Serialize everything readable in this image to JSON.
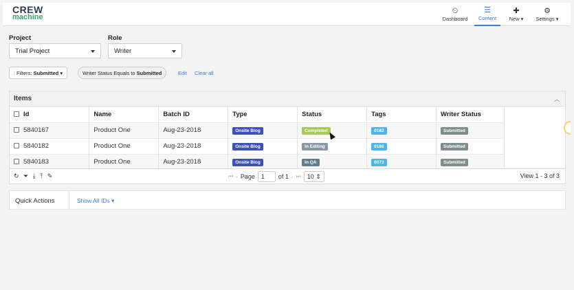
{
  "brand": {
    "line1": "CREW",
    "line2": "machine"
  },
  "nav": [
    {
      "icon": "dashboard-icon",
      "glyph": "⏲",
      "label": "Dashboard"
    },
    {
      "icon": "content-icon",
      "glyph": "☰",
      "label": "Content"
    },
    {
      "icon": "plus-icon",
      "glyph": "✚",
      "label": "New ▾"
    },
    {
      "icon": "gear-icon",
      "glyph": "⚙",
      "label": "Settings ▾"
    }
  ],
  "filters": {
    "project_label": "Project",
    "project_value": "Trial Project",
    "role_label": "Role",
    "role_value": "Writer",
    "filters_prefix": "Filters:",
    "filters_value": "Submitted",
    "chip_prefix": "Writer Status Equals to",
    "chip_value": "Submitted",
    "edit": "Edit",
    "clear": "Clear all"
  },
  "items": {
    "title": "Items",
    "columns": [
      "Id",
      "Name",
      "Batch ID",
      "Type",
      "Status",
      "Tags",
      "Writer Status"
    ],
    "rows": [
      {
        "id": "5840167",
        "name": "Product One",
        "batch": "Aug-23-2018",
        "type": "Onsite Blog",
        "status": "Completed",
        "tag": "0182",
        "writer_status": "Submitted"
      },
      {
        "id": "5840182",
        "name": "Product One",
        "batch": "Aug-23-2018",
        "type": "Onsite Blog",
        "status": "In Editing",
        "tag": "0186",
        "writer_status": "Submitted"
      },
      {
        "id": "5840183",
        "name": "Product One",
        "batch": "Aug-23-2018",
        "type": "Onsite Blog",
        "status": "In QA",
        "tag": "0073",
        "writer_status": "Submitted"
      }
    ],
    "colors": {
      "type": "#3f51b5",
      "Completed": "#a8c95a",
      "In Editing": "#8a96a3",
      "In QA": "#607d8b",
      "tag": "#4db6e8",
      "writer_status": "#7f8c8d"
    }
  },
  "pager": {
    "tools": "↻ ⏷ ⤓ ⤒ ✎",
    "page_label": "Page",
    "page_value": "1",
    "of_label": "of 1",
    "page_size": "10",
    "view_info": "View 1 - 3 of 3"
  },
  "quick": {
    "label": "Quick Actions",
    "show_all": "Show All IDs ▾"
  }
}
